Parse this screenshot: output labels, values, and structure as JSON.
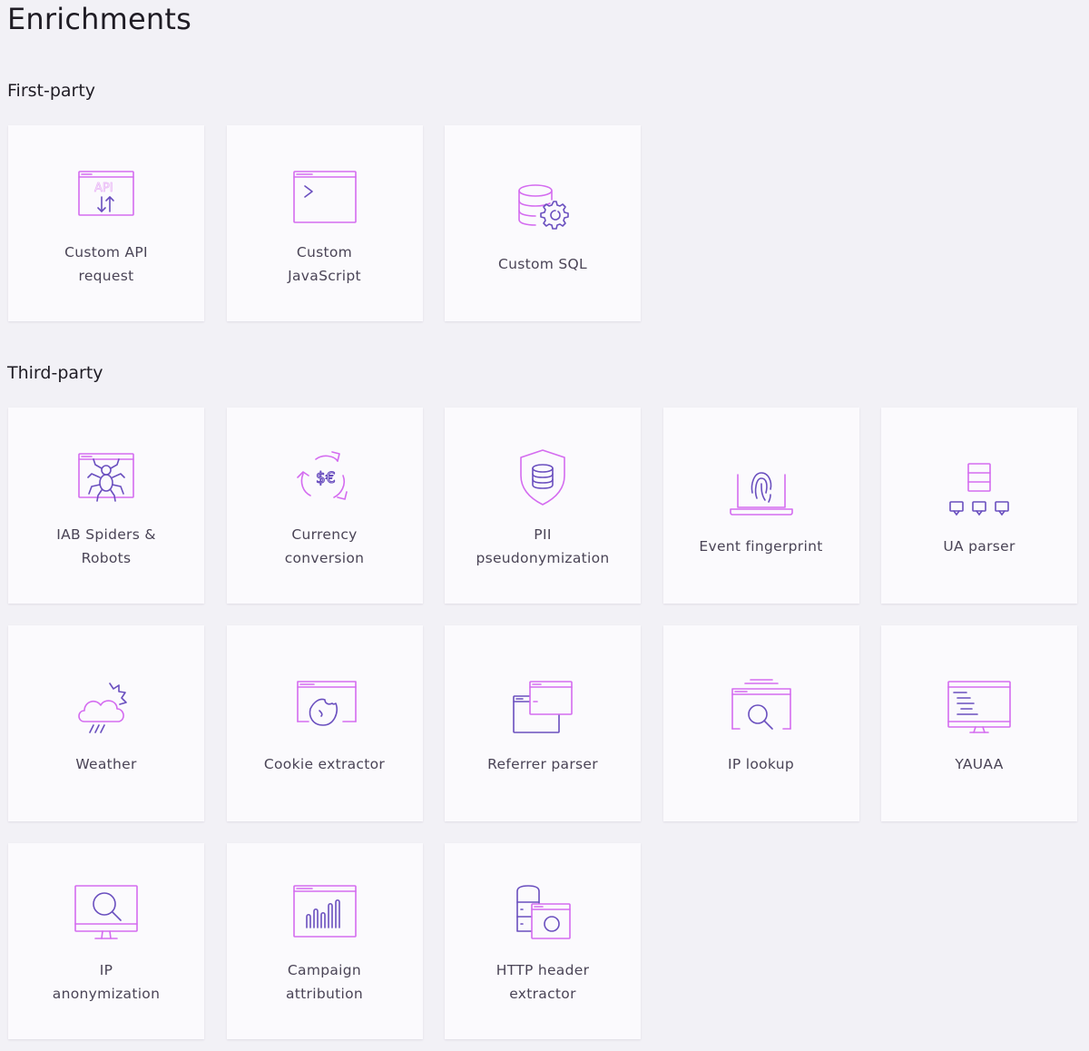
{
  "page": {
    "title": "Enrichments"
  },
  "sections": [
    {
      "title": "First-party",
      "items": [
        {
          "label": "Custom API\nrequest",
          "icon": "api-window-icon"
        },
        {
          "label": "Custom\nJavaScript",
          "icon": "terminal-window-icon"
        },
        {
          "label": "Custom SQL",
          "icon": "database-gear-icon"
        }
      ]
    },
    {
      "title": "Third-party",
      "items": [
        {
          "label": "IAB Spiders &\nRobots",
          "icon": "spider-window-icon"
        },
        {
          "label": "Currency\nconversion",
          "icon": "currency-cycle-icon"
        },
        {
          "label": "PII\npseudonymization",
          "icon": "shield-database-icon"
        },
        {
          "label": "Event fingerprint",
          "icon": "fingerprint-laptop-icon"
        },
        {
          "label": "UA parser",
          "icon": "server-devices-icon"
        },
        {
          "label": "Weather",
          "icon": "weather-cloud-icon"
        },
        {
          "label": "Cookie extractor",
          "icon": "cookie-window-icon"
        },
        {
          "label": "Referrer parser",
          "icon": "stacked-windows-icon"
        },
        {
          "label": "IP lookup",
          "icon": "search-window-icon"
        },
        {
          "label": "YAUAA",
          "icon": "code-monitor-icon"
        },
        {
          "label": "IP\nanonymization",
          "icon": "search-monitor-icon"
        },
        {
          "label": "Campaign\nattribution",
          "icon": "bar-chart-window-icon"
        },
        {
          "label": "HTTP header\nextractor",
          "icon": "server-window-icon"
        }
      ]
    }
  ]
}
